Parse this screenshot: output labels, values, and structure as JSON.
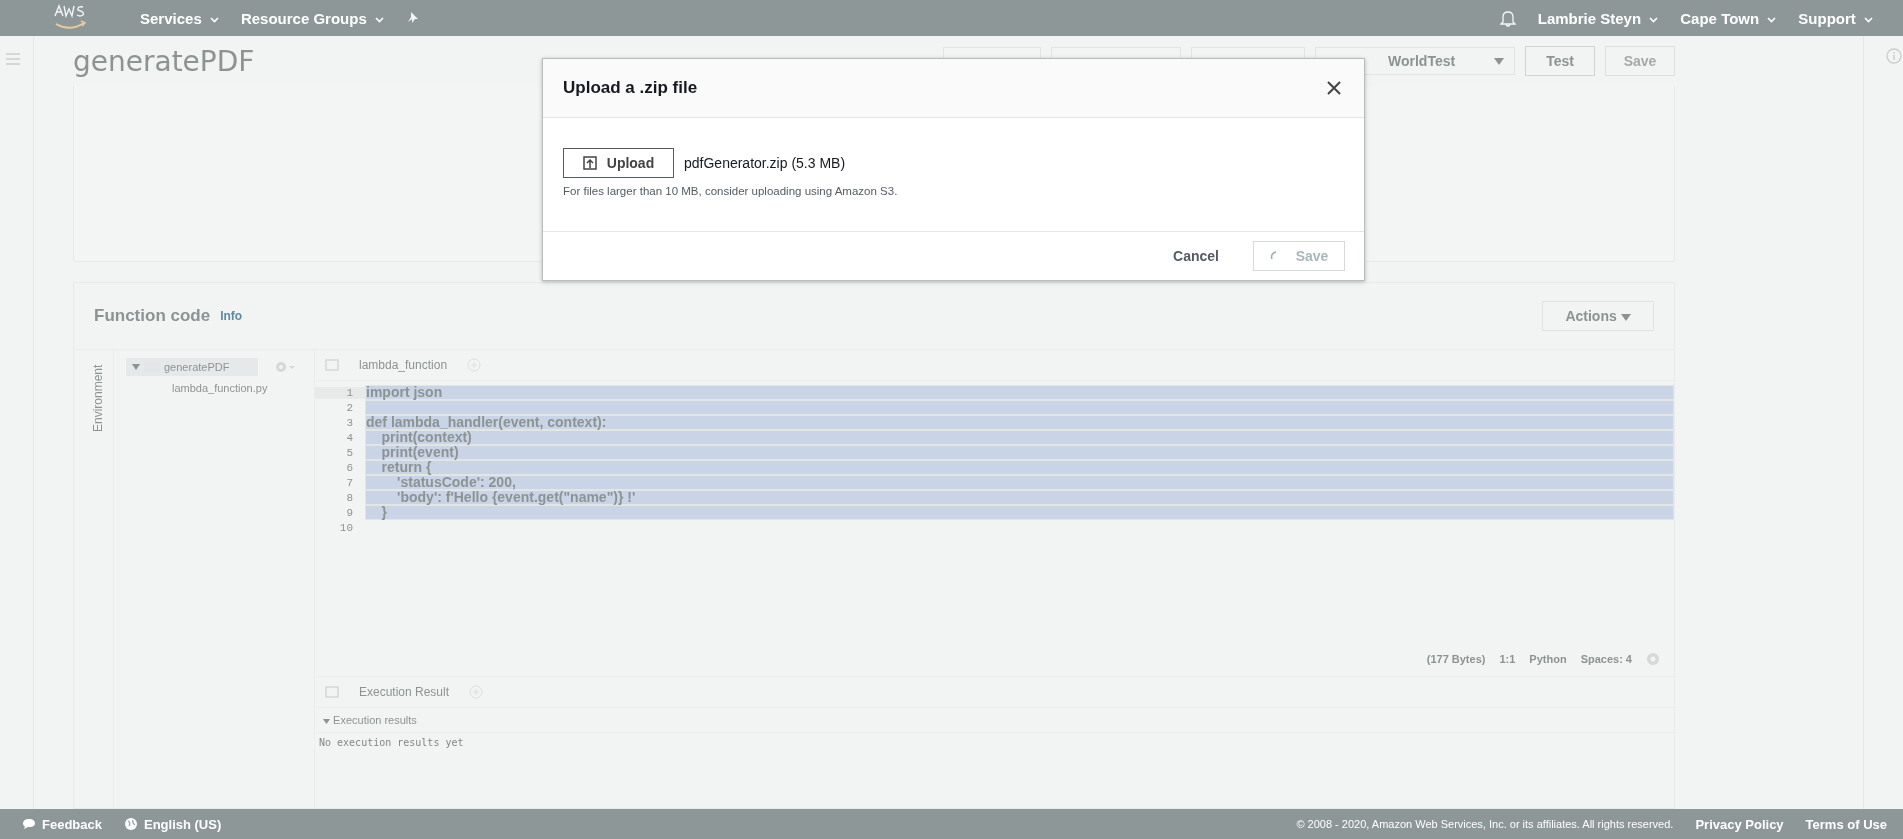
{
  "top_nav": {
    "services": "Services",
    "resource_groups": "Resource Groups",
    "user": "Lambrie Steyn",
    "region": "Cape Town",
    "support": "Support"
  },
  "header": {
    "title": "generatePDF",
    "qualifier_select": "WorldTest",
    "test_button": "Test",
    "save_button": "Save"
  },
  "function_code": {
    "title": "Function code",
    "info": "Info",
    "actions": "Actions",
    "environment": "Environment",
    "tree": {
      "folder": "generatePDF",
      "expanded": true,
      "files": [
        "lambda_function.py"
      ]
    },
    "tab": "lambda_function",
    "lines": [
      {
        "number": "1",
        "text": "import json",
        "selected": true
      },
      {
        "number": "2",
        "selected": true
      },
      {
        "number": "3",
        "text": "def lambda_handler(event, context):",
        "selected": true
      },
      {
        "number": "4",
        "text": "    print(context)",
        "selected": true
      },
      {
        "number": "5",
        "text": "    print(event)",
        "selected": true
      },
      {
        "number": "6",
        "text": "    return {",
        "selected": true
      },
      {
        "number": "7",
        "text": "        'statusCode': 200,",
        "selected": true
      },
      {
        "number": "8",
        "text": "        'body': f'Hello {event.get(\"name\")} !'",
        "selected": true
      },
      {
        "number": "9",
        "text": "    }",
        "selected": true
      },
      {
        "number": "10",
        "selected": false
      }
    ],
    "status": [
      "(177 Bytes)",
      "1:1",
      "Python",
      "Spaces: 4"
    ],
    "result_tab": "Execution Result",
    "results_heading": "Execution results",
    "results_text": "No execution results yet"
  },
  "footer": {
    "feedback": "Feedback",
    "language": "English (US)",
    "copyright": "© 2008 - 2020, Amazon Web Services, Inc. or its affiliates. All rights reserved.",
    "privacy": "Privacy Policy",
    "terms": "Terms of Use"
  },
  "modal": {
    "title": "Upload a .zip file",
    "upload_button": "Upload",
    "file_name": "pdfGenerator.zip (5.3 MB)",
    "hint": "For files larger than 10 MB, consider uploading using Amazon S3.",
    "cancel_button": "Cancel",
    "save_button": "Save",
    "saving": true
  }
}
